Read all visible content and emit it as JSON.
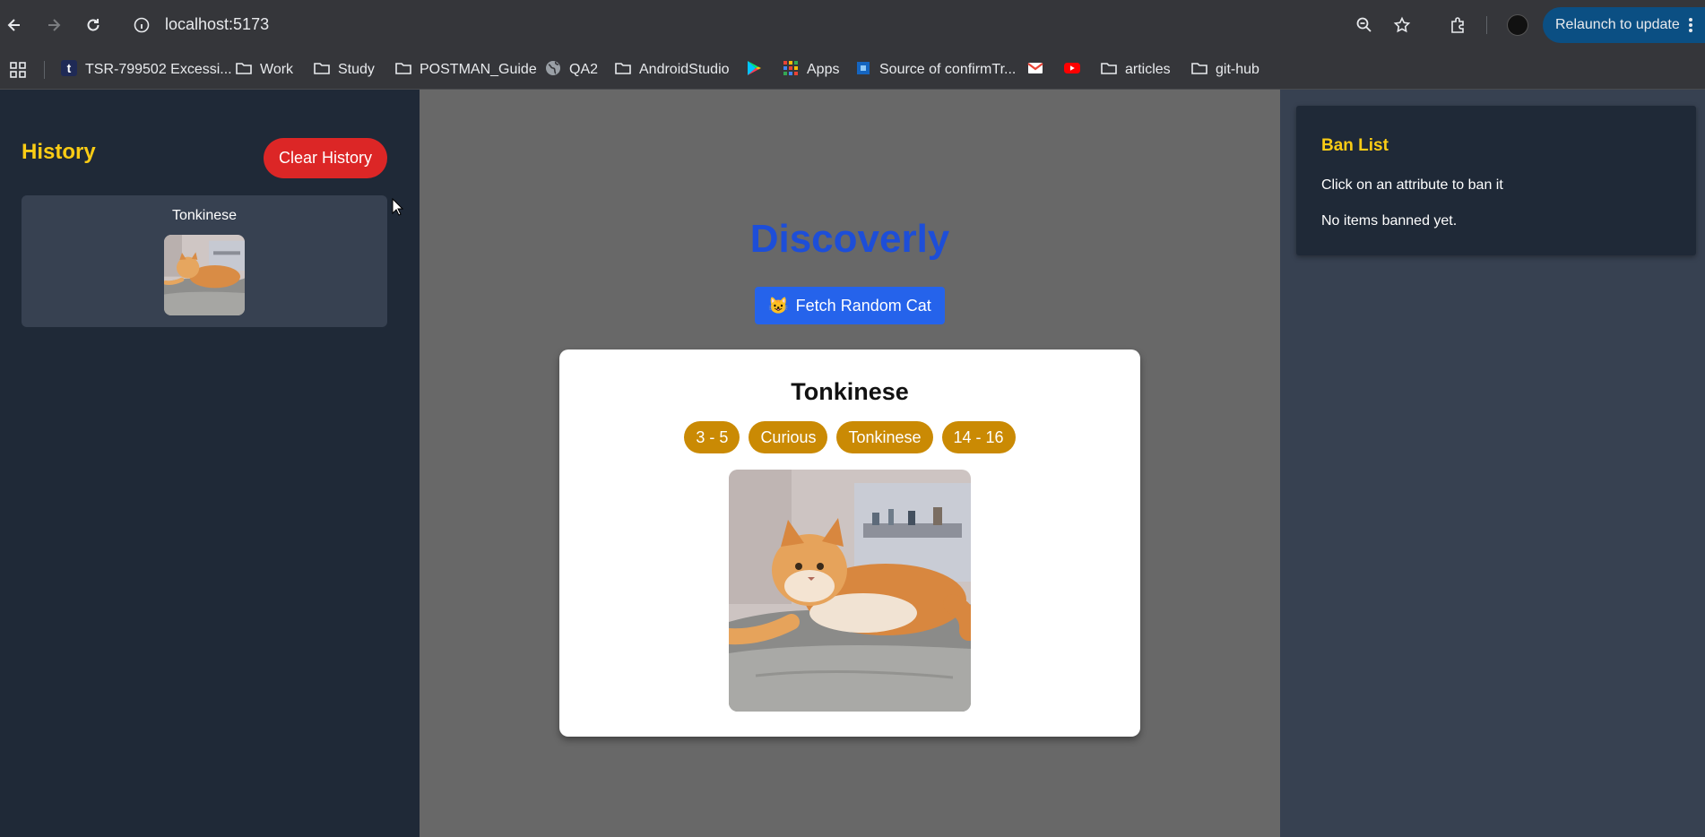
{
  "browser": {
    "url": "localhost:5173",
    "relaunch_label": "Relaunch to update",
    "bookmarks": [
      {
        "label": "TSR-799502 Excessi...",
        "icon": "tumblr-icon"
      },
      {
        "label": "Work",
        "icon": "folder-icon"
      },
      {
        "label": "Study",
        "icon": "folder-icon"
      },
      {
        "label": "POSTMAN_Guide",
        "icon": "folder-icon"
      },
      {
        "label": "QA2",
        "icon": "globe-icon"
      },
      {
        "label": "AndroidStudio",
        "icon": "folder-icon"
      },
      {
        "label": "",
        "icon": "play-store-icon"
      },
      {
        "label": "Apps",
        "icon": "apps-grid-icon"
      },
      {
        "label": "Source of confirmTr...",
        "icon": "page-icon"
      },
      {
        "label": "",
        "icon": "gmail-icon"
      },
      {
        "label": "",
        "icon": "youtube-icon"
      },
      {
        "label": "articles",
        "icon": "folder-icon"
      },
      {
        "label": "git-hub",
        "icon": "folder-icon"
      }
    ]
  },
  "history": {
    "title": "History",
    "clear_label": "Clear History",
    "items": [
      {
        "name": "Tonkinese"
      }
    ]
  },
  "main": {
    "app_title": "Discoverly",
    "fetch_emoji": "😺",
    "fetch_label": "Fetch Random Cat",
    "cat": {
      "name": "Tonkinese",
      "attributes": [
        "3 - 5",
        "Curious",
        "Tonkinese",
        "14 - 16"
      ]
    }
  },
  "ban_list": {
    "title": "Ban List",
    "hint": "Click on an attribute to ban it",
    "empty_text": "No items banned yet."
  },
  "colors": {
    "accent_yellow": "#facc15",
    "clear_red": "#dc2626",
    "fetch_blue": "#2563eb",
    "title_blue": "#1d4ed8",
    "attribute_gold": "#ca8a04"
  }
}
